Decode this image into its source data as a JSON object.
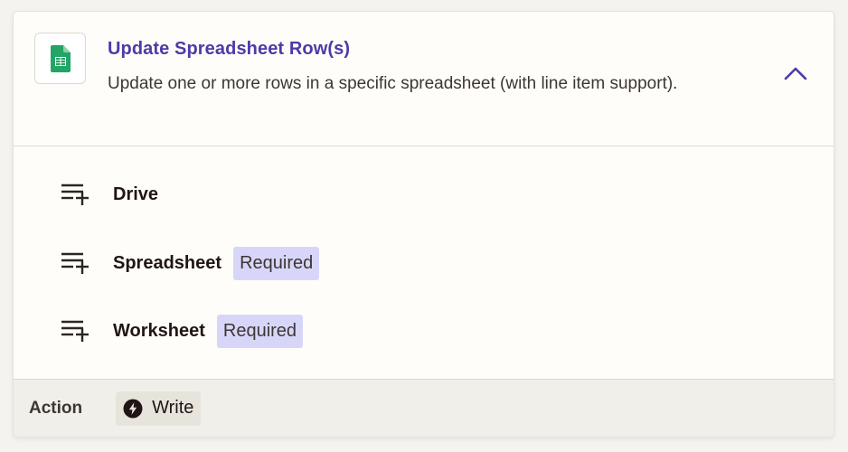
{
  "step": {
    "app_icon": "google-sheets-icon",
    "title": "Update Spreadsheet Row(s)",
    "description": "Update one or more rows in a specific spreadsheet (with line item support).",
    "collapse_icon": "chevron-up-icon",
    "accent_color": "#4e3aa8"
  },
  "fields": [
    {
      "label": "Drive",
      "icon": "list-add-icon",
      "badge": ""
    },
    {
      "label": "Spreadsheet",
      "icon": "list-add-icon",
      "badge": "Required"
    },
    {
      "label": "Worksheet",
      "icon": "list-add-icon",
      "badge": "Required"
    }
  ],
  "footer": {
    "label": "Action",
    "chip_icon": "bolt-icon",
    "chip_text": "Write"
  },
  "colors": {
    "badge_bg": "#d8d6f8",
    "footer_bg": "#f1efe9",
    "sheets_green": "#23a566"
  }
}
